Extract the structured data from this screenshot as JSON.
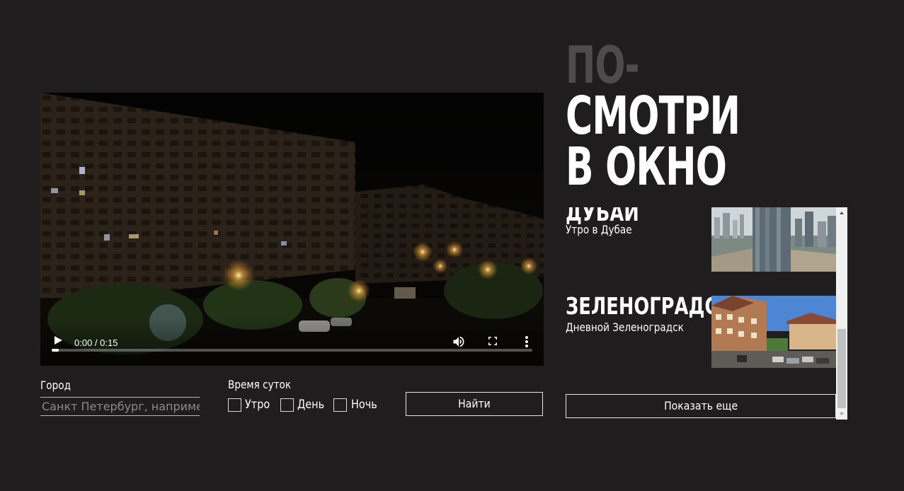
{
  "title": {
    "line1": "ПО-",
    "line2": "СМОТРИ",
    "line3": "В ОКНО"
  },
  "video": {
    "time": "0:00 / 0:15",
    "progress_fraction": 0.015
  },
  "form": {
    "city_label": "Город",
    "city_placeholder": "Санкт Петербург, например",
    "time_of_day_label": "Время суток",
    "options": [
      "Утро",
      "День",
      "Ночь"
    ],
    "find_label": "Найти"
  },
  "list": {
    "items": [
      {
        "city": "ДУБАЙ",
        "description": "Утро в Дубае"
      },
      {
        "city": "ЗЕЛЕНОГРАДСК",
        "description": "Дневной Зеленоградск"
      }
    ],
    "show_more_label": "Показать еще"
  },
  "colors": {
    "background": "#1f1d1e",
    "title_dim": "#4d4b4c",
    "text": "#ffffff"
  },
  "icons": [
    "play-icon",
    "volume-icon",
    "fullscreen-icon",
    "more-vertical-icon",
    "scroll-up-arrow-icon",
    "scroll-down-arrow-icon"
  ]
}
